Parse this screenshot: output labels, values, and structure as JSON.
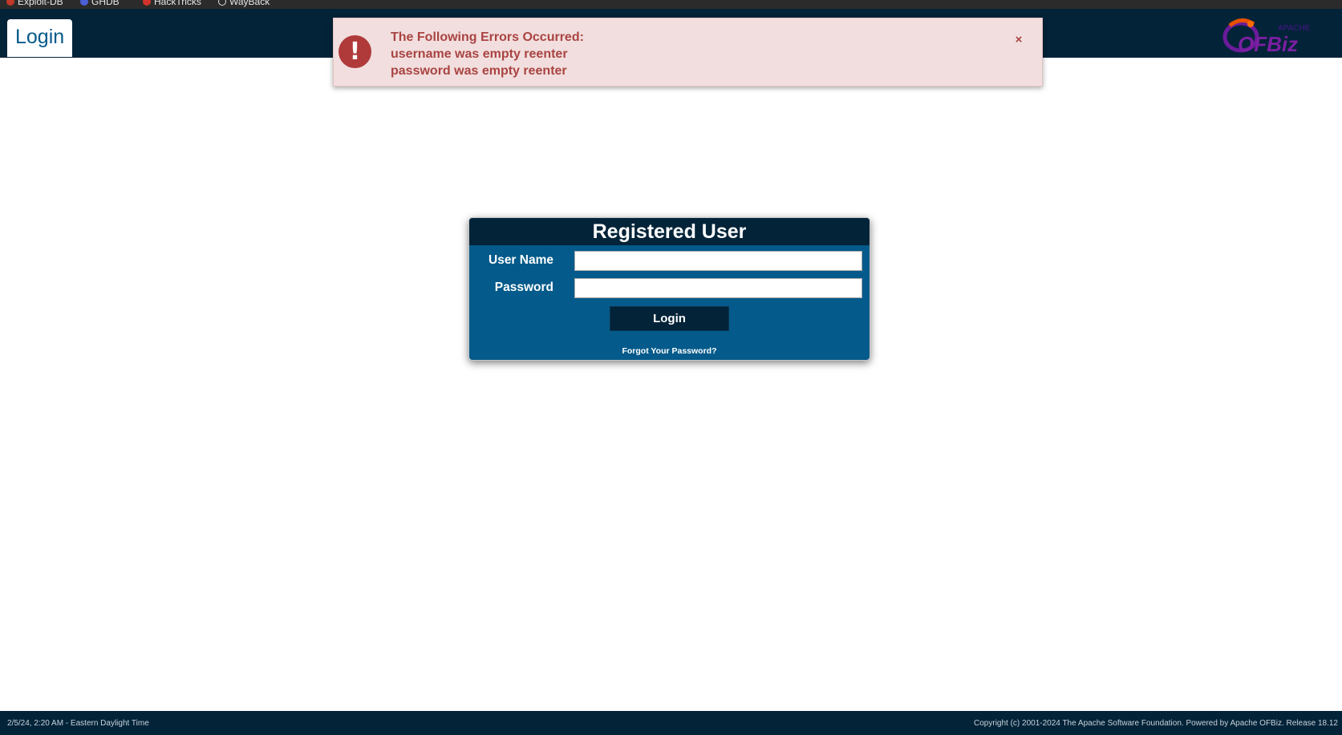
{
  "bookmarks": [
    {
      "label": "Exploit-DB",
      "icon": "exploit-db-icon",
      "color": "#c0392b"
    },
    {
      "label": "GHDB",
      "icon": "ghdb-icon",
      "color": "#4c5fd7"
    },
    {
      "label": "HackTricks",
      "icon": "hacktricks-icon",
      "color": "#d0342c"
    },
    {
      "label": "WayBack",
      "icon": "wayback-icon",
      "color": "#dddddd"
    }
  ],
  "header": {
    "app_tab": "Login",
    "logo_text": "OFBiz",
    "logo_sub": "APACHE"
  },
  "alert": {
    "title": "The Following Errors Occurred:",
    "messages": [
      "username was empty reenter",
      "password was empty reenter"
    ],
    "close_label": "×",
    "icon": "exclamation-icon"
  },
  "login": {
    "title": "Registered User",
    "username_label": "User Name",
    "username_value": "",
    "password_label": "Password",
    "password_value": "",
    "submit_label": "Login",
    "forgot_label": "Forgot Your Password?"
  },
  "footer": {
    "datetime": "2/5/24, 2:20 AM - Eastern Daylight Time",
    "copyright": "Copyright (c) 2001-2024 The Apache Software Foundation. Powered by Apache OFBiz. Release 18.12"
  },
  "colors": {
    "header_bg": "#022338",
    "panel_bg": "#045a8a",
    "alert_bg": "#f2dede",
    "alert_text": "#a94442"
  }
}
